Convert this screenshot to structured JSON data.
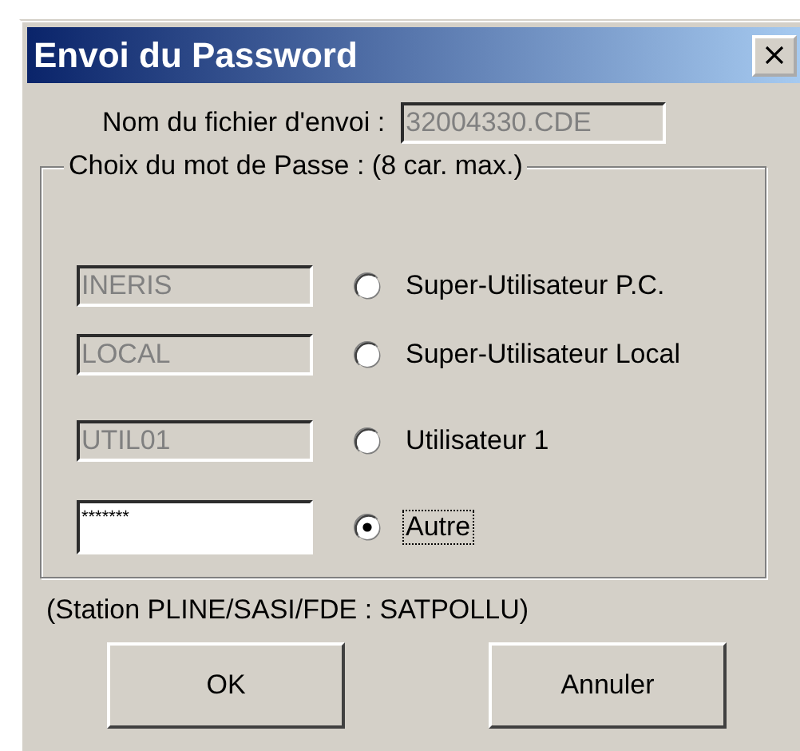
{
  "window": {
    "title": "Envoi du Password"
  },
  "file": {
    "label": "Nom du fichier d'envoi :",
    "value": "32004330.CDE",
    "disabled": true
  },
  "group": {
    "legend": "Choix du mot de Passe : (8 car. max.)",
    "options": [
      {
        "value": "INERIS",
        "label": "Super-Utilisateur P.C.",
        "selected": false,
        "disabled": true
      },
      {
        "value": "LOCAL",
        "label": "Super-Utilisateur Local",
        "selected": false,
        "disabled": true
      },
      {
        "value": "UTIL01",
        "label": "Utilisateur 1",
        "selected": false,
        "disabled": true
      },
      {
        "value": "*******",
        "label": "Autre",
        "selected": true,
        "disabled": false
      }
    ]
  },
  "note": "(Station PLINE/SASI/FDE : SATPOLLU)",
  "buttons": [
    "OK",
    "Annuler"
  ]
}
